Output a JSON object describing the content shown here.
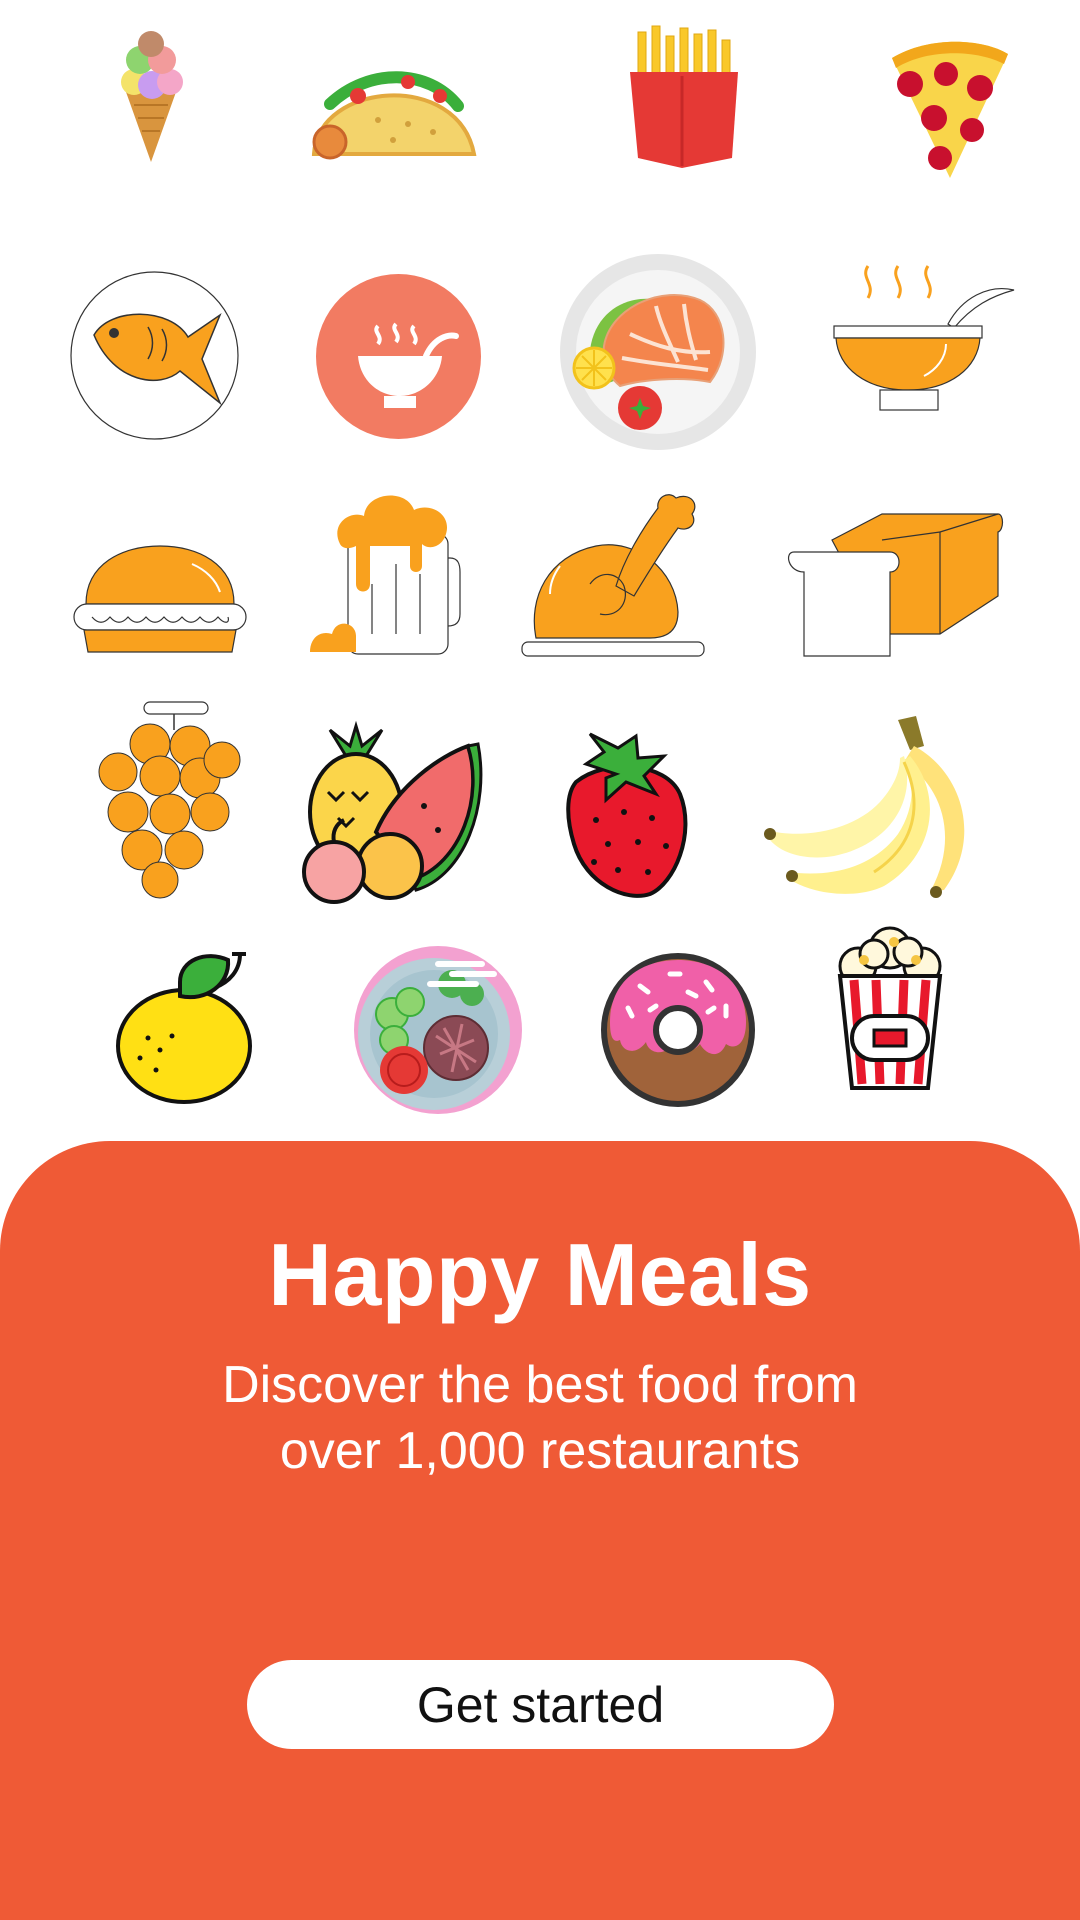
{
  "icons": [
    {
      "name": "ice-cream-cone-icon"
    },
    {
      "name": "taco-icon"
    },
    {
      "name": "french-fries-icon"
    },
    {
      "name": "pizza-slice-icon"
    },
    {
      "name": "fish-icon"
    },
    {
      "name": "soup-bowl-icon"
    },
    {
      "name": "salmon-plate-icon"
    },
    {
      "name": "hot-soup-icon"
    },
    {
      "name": "burger-bun-icon"
    },
    {
      "name": "beer-mug-icon"
    },
    {
      "name": "roast-chicken-icon"
    },
    {
      "name": "bread-loaf-icon"
    },
    {
      "name": "grapes-icon"
    },
    {
      "name": "mixed-fruits-icon"
    },
    {
      "name": "strawberry-icon"
    },
    {
      "name": "bananas-icon"
    },
    {
      "name": "lemon-icon"
    },
    {
      "name": "salad-bowl-icon"
    },
    {
      "name": "donut-icon"
    },
    {
      "name": "popcorn-icon"
    }
  ],
  "colors": {
    "accent": "#EF5A36",
    "icon_orange": "#F9A11E",
    "button_bg": "#FFFFFF",
    "button_text": "#111111"
  },
  "hero": {
    "title": "Happy Meals",
    "subtitle": "Discover the best food from over 1,000 restaurants"
  },
  "cta": {
    "label": "Get started"
  }
}
